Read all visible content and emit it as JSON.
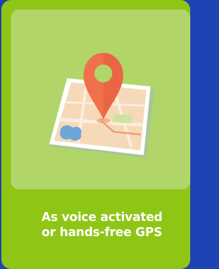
{
  "card": {
    "caption_line1": "As voice activated",
    "caption_line2": "or hands-free GPS",
    "icon": "map-location-pin-icon"
  },
  "colors": {
    "background_blue": "#1e43b4",
    "card_green": "#8fc515",
    "image_green": "#b2d56a",
    "pin_orange": "#f0704c",
    "text": "#ffffff"
  }
}
